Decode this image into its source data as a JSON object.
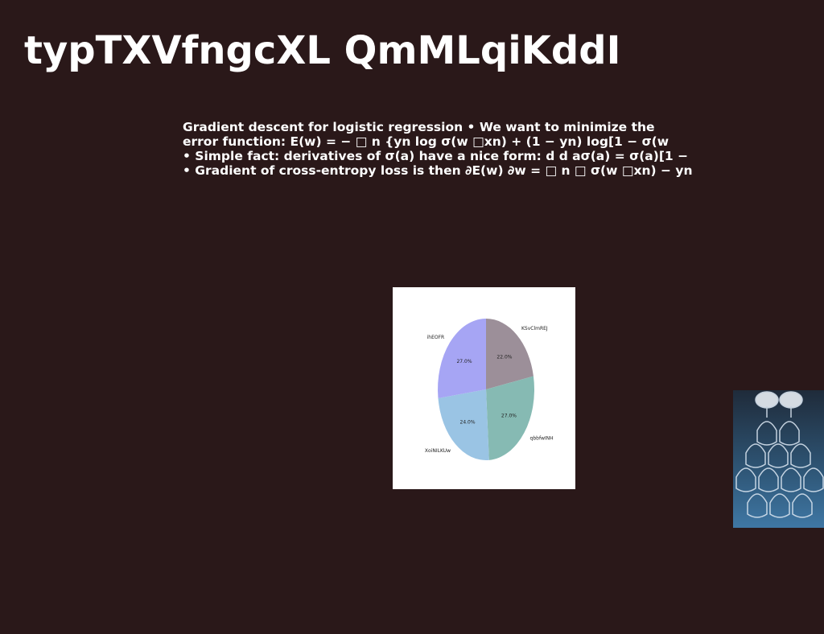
{
  "slide": {
    "title": "typTXVfngcXL QmMLqiKddI",
    "body_lines": [
      "Gradient descent for logistic regression • We want to minimize the",
      "error function: E(w) = − □ n {yn log σ(w □xn) + (1 − yn) log[1 − σ(w",
      "• Simple fact: derivatives of σ(a) have a nice form: d d aσ(a) = σ(a)[1 −",
      "• Gradient of cross-entropy loss is then ∂E(w) ∂w = □ n □ σ(w □xn) − yn"
    ]
  },
  "chart_data": {
    "type": "pie",
    "slices": [
      {
        "label": "KSvClmREJ",
        "value": 22.0,
        "pct_label": "22.0%",
        "color": "#9c8f99"
      },
      {
        "label": "qbbfwINH",
        "value": 27.0,
        "pct_label": "27.0%",
        "color": "#86bab3"
      },
      {
        "label": "XoiNILKUw",
        "value": 24.0,
        "pct_label": "24.0%",
        "color": "#9ac4e4"
      },
      {
        "label": "ihEOFR",
        "value": 27.0,
        "pct_label": "27.0%",
        "color": "#a6a5f4"
      }
    ],
    "start": "top",
    "direction": "clockwise"
  },
  "photo": {
    "icon": "champagne-glass-tower-photo"
  }
}
